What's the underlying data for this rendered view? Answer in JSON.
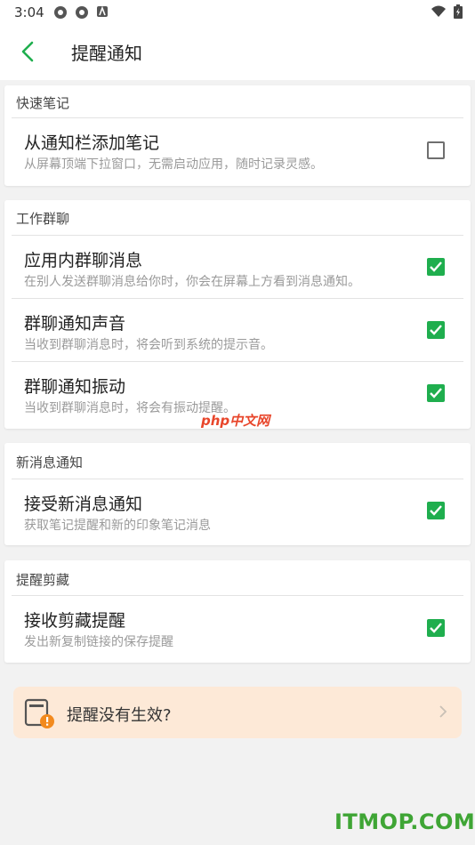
{
  "status": {
    "time": "3:04"
  },
  "header": {
    "title": "提醒通知"
  },
  "sections": [
    {
      "header": "快速笔记",
      "items": [
        {
          "title": "从通知栏添加笔记",
          "subtitle": "从屏幕顶端下拉窗口，无需启动应用，随时记录灵感。",
          "checked": false
        }
      ]
    },
    {
      "header": "工作群聊",
      "items": [
        {
          "title": "应用内群聊消息",
          "subtitle": "在别人发送群聊消息给你时，你会在屏幕上方看到消息通知。",
          "checked": true
        },
        {
          "title": "群聊通知声音",
          "subtitle": "当收到群聊消息时，将会听到系统的提示音。",
          "checked": true
        },
        {
          "title": "群聊通知振动",
          "subtitle": "当收到群聊消息时，将会有振动提醒。",
          "checked": true
        }
      ]
    },
    {
      "header": "新消息通知",
      "items": [
        {
          "title": "接受新消息通知",
          "subtitle": "获取笔记提醒和新的印象笔记消息",
          "checked": true
        }
      ]
    },
    {
      "header": "提醒剪藏",
      "items": [
        {
          "title": "接收剪藏提醒",
          "subtitle": "发出新复制链接的保存提醒",
          "checked": true
        }
      ]
    }
  ],
  "help": {
    "label": "提醒没有生效?"
  },
  "watermarks": {
    "php": "php中文网",
    "itmop": "ITMOP.COM"
  },
  "colors": {
    "accent": "#1fae4e",
    "help_bg": "#fde9d7"
  }
}
